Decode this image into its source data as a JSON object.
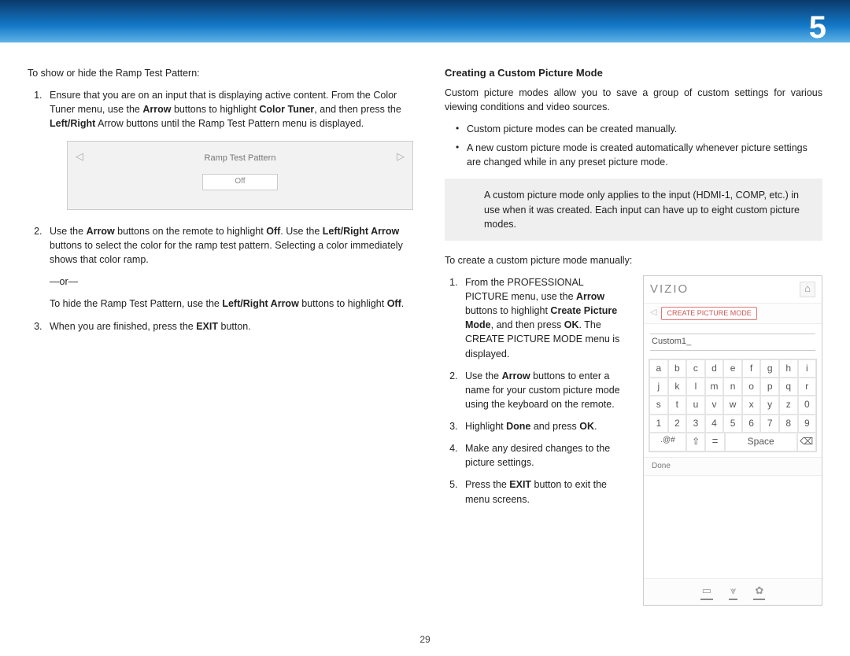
{
  "chapter": "5",
  "page_number": "29",
  "left": {
    "intro": "To show or hide the Ramp Test Pattern:",
    "step1_a": "Ensure that you are on an input that is displaying active content. From the Color Tuner menu, use the ",
    "step1_b": " buttons to highlight ",
    "step1_c": ", and then press the ",
    "step1_d": " Arrow buttons until the Ramp Test Pattern menu is displayed.",
    "b_arrow": "Arrow",
    "b_ct": "Color Tuner",
    "b_lr": "Left/Right",
    "ramp_title": "Ramp Test Pattern",
    "ramp_off": "Off",
    "step2_a": "Use the ",
    "step2_b": " buttons on the remote to highlight ",
    "step2_c": ". Use the ",
    "step2_d": " buttons to select the color for the ramp test pattern. Selecting a color immediately shows that color ramp.",
    "b_off": "Off",
    "b_lra": "Left/Right Arrow",
    "or": "—or—",
    "hide_a": "To hide the Ramp Test Pattern, use the ",
    "hide_b": " buttons to highlight ",
    "hide_c": ".",
    "step3_a": "When you are finished, press the ",
    "step3_b": " button.",
    "b_exit": "EXIT"
  },
  "right": {
    "heading": "Creating a Custom Picture Mode",
    "intro": "Custom picture modes allow you to save a group of custom settings for various viewing conditions and video sources.",
    "bullet1": "Custom picture modes can be created manually.",
    "bullet2": "A new custom picture mode is created automatically whenever picture settings are changed while in any preset picture mode.",
    "note": "A custom picture mode only applies to the input (HDMI-1, COMP, etc.) in use when it was created. Each input can have up to eight custom picture modes.",
    "create_intro": "To create a custom picture mode manually:",
    "s1_a": "From the PROFESSIONAL PICTURE menu, use the ",
    "s1_b": " buttons to highlight ",
    "s1_c": ", and then press ",
    "s1_d": ". The CREATE PICTURE MODE menu is displayed.",
    "b_arrow": "Arrow",
    "b_cpm": "Create Picture Mode",
    "b_ok": "OK",
    "s2_a": "Use the ",
    "s2_b": " buttons to enter a name for your custom picture mode using the keyboard on the remote.",
    "s3_a": "Highlight ",
    "s3_b": " and press ",
    "s3_c": ".",
    "b_done": "Done",
    "s4": "Make any desired changes to the picture settings.",
    "s5_a": "Press the ",
    "s5_b": " button to exit the menu screens.",
    "b_exit": "EXIT"
  },
  "vizio": {
    "logo": "VIZIO",
    "crumb": "CREATE PICTURE MODE",
    "input": "Custom1_",
    "row1": [
      "a",
      "b",
      "c",
      "d",
      "e",
      "f",
      "g",
      "h",
      "i"
    ],
    "row2": [
      "j",
      "k",
      "l",
      "m",
      "n",
      "o",
      "p",
      "q",
      "r"
    ],
    "row3": [
      "s",
      "t",
      "u",
      "v",
      "w",
      "x",
      "y",
      "z",
      "0"
    ],
    "row4": [
      "1",
      "2",
      "3",
      "4",
      "5",
      "6",
      "7",
      "8",
      "9"
    ],
    "row5_sym": ".@#",
    "row5_shift": "⇧",
    "row5_mic": "ꘌ",
    "row5_space": "Space",
    "row5_del": "⌫",
    "done": "Done",
    "footer": [
      "▭",
      "⩔",
      "✿"
    ]
  }
}
